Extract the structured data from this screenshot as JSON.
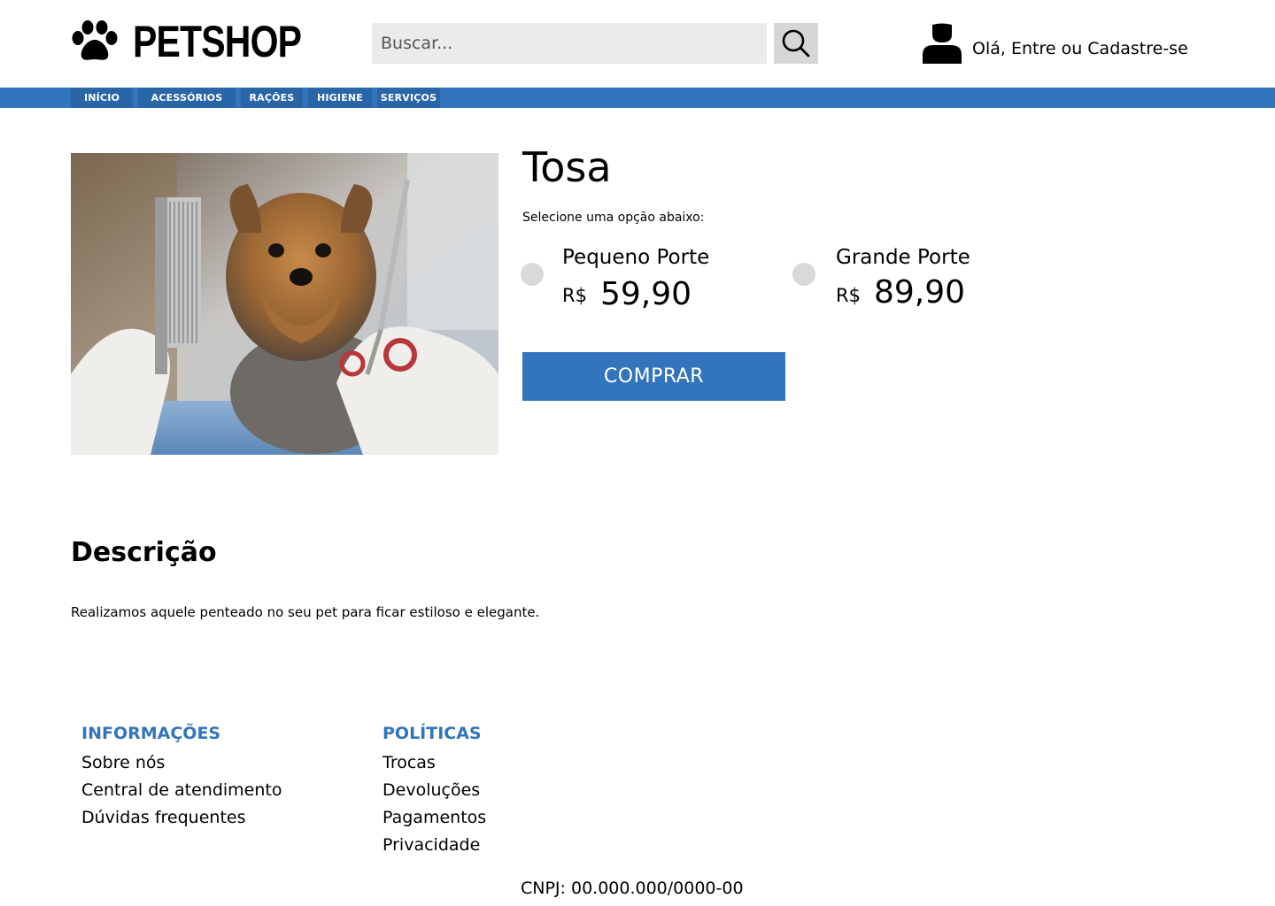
{
  "header": {
    "logo_text": "PETSHOP",
    "search_placeholder": "Buscar...",
    "user_greeting": "Olá, Entre ou Cadastre-se"
  },
  "nav": {
    "items": [
      {
        "label": "INÍCIO"
      },
      {
        "label": "ACESSÓRIOS"
      },
      {
        "label": "RAÇÕES"
      },
      {
        "label": "HIGIENE"
      },
      {
        "label": "SERVIÇOS"
      }
    ]
  },
  "product": {
    "title": "Tosa",
    "select_label": "Selecione uma opção abaixo:",
    "options": [
      {
        "name": "Pequeno Porte",
        "currency": "R$",
        "price": "59,90"
      },
      {
        "name": "Grande Porte",
        "currency": "R$",
        "price": "89,90"
      }
    ],
    "buy_label": "COMPRAR"
  },
  "description": {
    "title": "Descrição",
    "text": "Realizamos aquele penteado no seu pet para ficar estiloso e elegante."
  },
  "footer": {
    "info": {
      "title": "INFORMAÇÕES",
      "links": [
        "Sobre nós",
        "Central de atendimento",
        "Dúvidas frequentes"
      ]
    },
    "policies": {
      "title": "POLÍTICAS",
      "links": [
        "Trocas",
        "Devoluções",
        "Pagamentos",
        "Privacidade"
      ]
    },
    "cnpj": "CNPJ: 00.000.000/0000-00"
  },
  "colors": {
    "brand_blue": "#3275bc",
    "nav_item_bg": "#2966a8",
    "search_bg": "#ebebeb",
    "radio_bg": "#d9d9d9"
  },
  "icons": {
    "logo": "paw-icon",
    "search": "search-icon",
    "user": "user-icon"
  }
}
